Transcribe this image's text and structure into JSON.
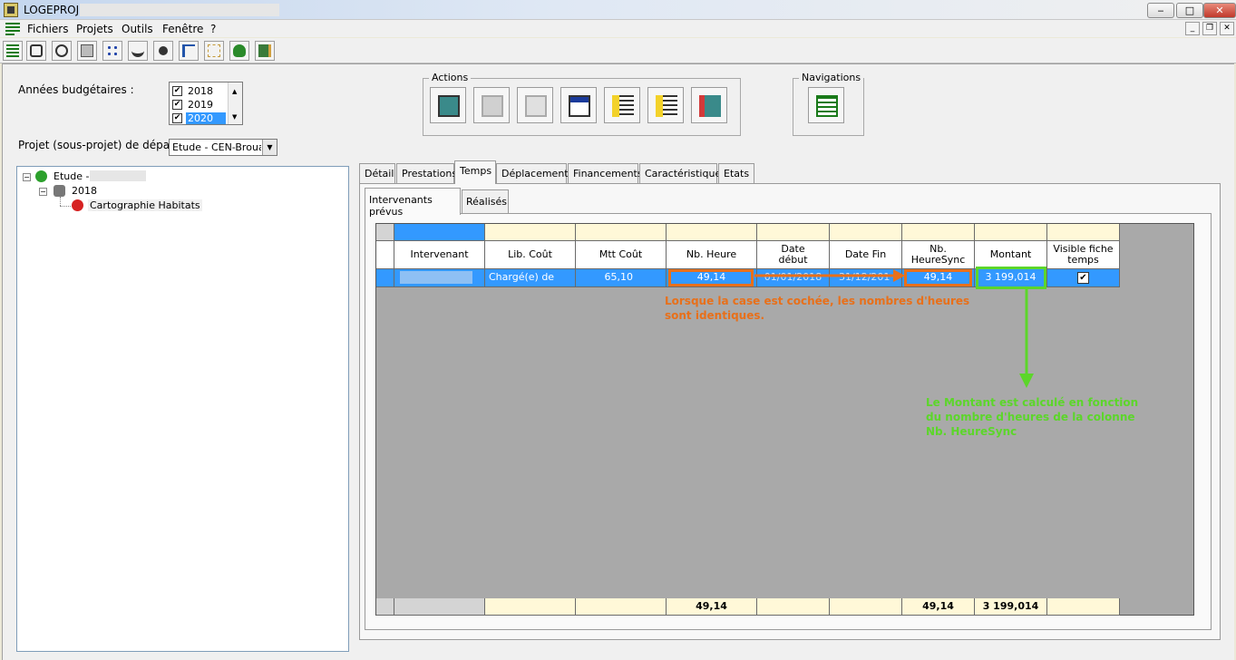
{
  "window": {
    "title": "LOGEPROJ",
    "controls": {
      "minimize": "‒",
      "maximize": "□",
      "close": "✕"
    },
    "mdi_controls": {
      "minimize": "_",
      "restore": "❐",
      "close": "✕"
    }
  },
  "menu": {
    "items": [
      "Fichiers",
      "Projets",
      "Outils",
      "Fenêtre",
      "?"
    ]
  },
  "toolbar": {
    "icons": [
      "grid-list-icon",
      "camera-icon",
      "stopwatch-icon",
      "document-icon",
      "network-icon",
      "handshake-icon",
      "person-chart-icon",
      "hierarchy-icon",
      "flowchart-icon",
      "frog-icon",
      "door-exit-icon"
    ]
  },
  "filters": {
    "years_label": "Années budgétaires :",
    "years": [
      {
        "label": "2018",
        "checked": "✔",
        "selected": false
      },
      {
        "label": "2019",
        "checked": "✔",
        "selected": false
      },
      {
        "label": "2020",
        "checked": "✔",
        "selected": true
      }
    ],
    "scroll_up": "▲",
    "scroll_down": "▼",
    "project_label": "Projet (sous-projet) de départ :",
    "project_value": "Etude - CEN-Brouage",
    "project_arrow": "▼"
  },
  "actions": {
    "title": "Actions",
    "buttons": [
      "monitor-gear-icon",
      "floppy-disk-icon",
      "excel-sheet-icon",
      "window-list-icon",
      "add-row-icon",
      "remove-row-icon",
      "exit-door-icon"
    ]
  },
  "navigations": {
    "title": "Navigations",
    "button_icon": "table-grid-icon"
  },
  "tree": {
    "expand_sign": "−",
    "root_label": "Etude -",
    "year_label": "2018",
    "leaf_label": "Cartographie Habitats"
  },
  "tabs": [
    "Détail",
    "Prestations",
    "Temps",
    "Déplacements",
    "Financements",
    "Caractéristiques",
    "Etats"
  ],
  "active_tab": "Temps",
  "subtabs": [
    "Intervenants prévus",
    "Réalisés"
  ],
  "active_subtab": "Intervenants prévus",
  "grid": {
    "headers": [
      "Intervenant",
      "Lib. Coût",
      "Mtt Coût",
      "Nb. Heure",
      "Date début",
      "Date Fin",
      "Nb. HeureSync",
      "Montant",
      "Visible fiche temps"
    ],
    "row": {
      "intervenant": "",
      "lib_cout": "Chargé(e) de mis…",
      "mtt_cout": "65,10",
      "nb_heure": "49,14",
      "date_debut": "01/01/2018",
      "date_fin": "31/12/201",
      "nb_heure_sync": "49,14",
      "montant": "3 199,014",
      "visible": "✔"
    },
    "totals": {
      "nb_heure": "49,14",
      "nb_heure_sync": "49,14",
      "montant": "3 199,014"
    }
  },
  "annotations": {
    "orange_text": "Lorsque la case est cochée, les nombres d'heures sont identiques.",
    "green_text": "Le Montant est calculé en fonction du nombre d'heures de la colonne Nb. HeureSync",
    "orange_color": "#e8701a",
    "green_color": "#5cd62a"
  }
}
